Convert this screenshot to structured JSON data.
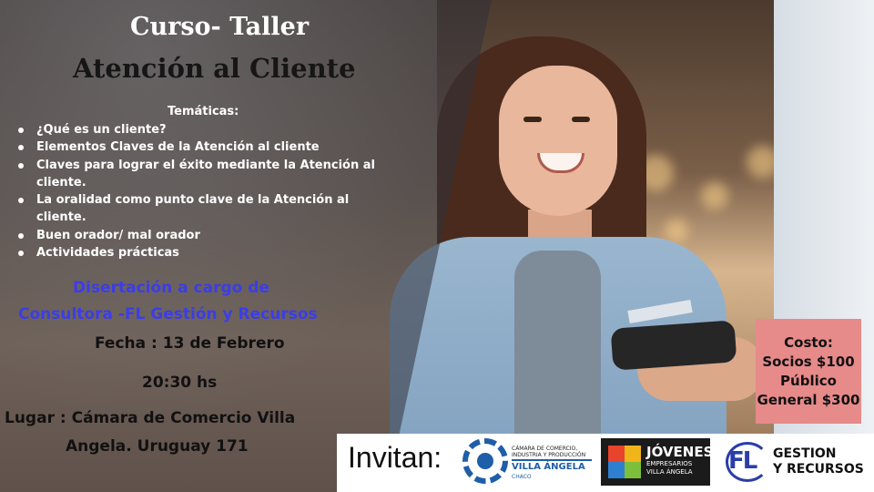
{
  "header": {
    "title_line1": "Curso- Taller",
    "title_line2": "Atención al Cliente"
  },
  "topics": {
    "heading": "Temáticas:",
    "items": [
      "¿Qué es un cliente?",
      "Elementos Claves de la Atención al cliente",
      "Claves para lograr el éxito mediante la Atención al cliente.",
      "La oralidad como punto clave de la Atención al cliente.",
      "Buen orador/ mal  orador",
      "Actividades  prácticas"
    ]
  },
  "speaker": {
    "line1": "Disertación a cargo  de",
    "line2": "Consultora -FL Gestión y Recursos"
  },
  "event": {
    "date": "Fecha : 13 de Febrero",
    "time": "20:30 hs",
    "place_line1": "Lugar : Cámara de Comercio Villa",
    "place_line2": "Angela. Uruguay 171"
  },
  "pricing": {
    "label": "Costo:",
    "members": "Socios $100",
    "public_line1": "Público",
    "public_line2": "General $300"
  },
  "sponsors": {
    "invite_label": "Invitan:",
    "camara": {
      "small": "CÁMARA DE COMERCIO, INDUSTRIA Y PRODUCCIÓN",
      "name": "VILLA ÁNGELA",
      "region": "CHACO"
    },
    "jovenes": {
      "name": "JÓVENES",
      "subtitle": "EMPRESARIOS VILLA ÁNGELA"
    },
    "fl": {
      "mark": "FL",
      "line1": "GESTION",
      "line2": "Y RECURSOS"
    }
  },
  "colors": {
    "speaker_text": "#3b3de8",
    "price_box": "#e78a8a",
    "camara_blue": "#1f5ea8",
    "fl_blue": "#2b3ea8"
  }
}
